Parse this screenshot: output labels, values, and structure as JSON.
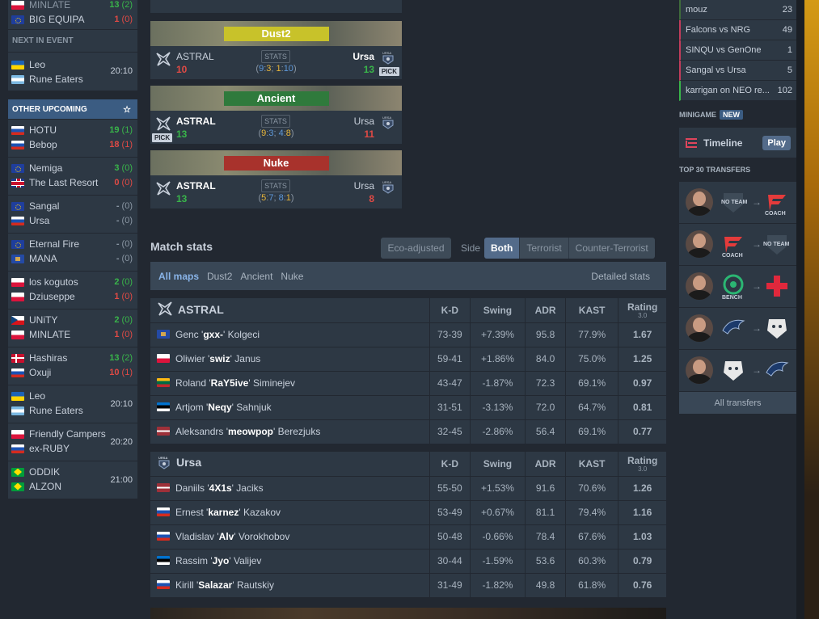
{
  "left_sidebar": {
    "top_match": {
      "team1": "MINLATE",
      "score1": "13",
      "pr1": "(2)",
      "team2": "BIG EQUIPA",
      "score2": "1",
      "pr2": "(0)"
    },
    "next_in_event_label": "NEXT IN EVENT",
    "next_match": {
      "team1": "Leo",
      "team2": "Rune Eaters",
      "time": "20:10"
    },
    "other_upcoming_label": "OTHER UPCOMING",
    "matches": [
      {
        "team1": "HOTU",
        "flag1": "ru",
        "score1": "19",
        "pr1": "(1)",
        "state1": "win",
        "team2": "Bebop",
        "flag2": "ru",
        "score2": "18",
        "pr2": "(1)",
        "state2": "lose"
      },
      {
        "team1": "Nemiga",
        "flag1": "eu",
        "score1": "3",
        "pr1": "(0)",
        "state1": "win",
        "team2": "The Last Resort",
        "flag2": "gb",
        "score2": "0",
        "pr2": "(0)",
        "state2": "lose"
      },
      {
        "team1": "Sangal",
        "flag1": "eu",
        "score1": "-",
        "pr1": "(0)",
        "state1": "none",
        "team2": "Ursa",
        "flag2": "ru",
        "score2": "-",
        "pr2": "(0)",
        "state2": "none"
      },
      {
        "team1": "Eternal Fire",
        "flag1": "eu",
        "score1": "-",
        "pr1": "(0)",
        "state1": "none",
        "team2": "MANA",
        "flag2": "xk",
        "score2": "-",
        "pr2": "(0)",
        "state2": "none"
      },
      {
        "team1": "los kogutos",
        "flag1": "pl",
        "score1": "2",
        "pr1": "(0)",
        "state1": "win",
        "team2": "Dziuseppe",
        "flag2": "pl",
        "score2": "1",
        "pr2": "(0)",
        "state2": "lose"
      },
      {
        "team1": "UNiTY",
        "flag1": "cz",
        "score1": "2",
        "pr1": "(0)",
        "state1": "win",
        "team2": "MINLATE",
        "flag2": "pl",
        "score2": "1",
        "pr2": "(0)",
        "state2": "lose"
      },
      {
        "team1": "Hashiras",
        "flag1": "dk",
        "score1": "13",
        "pr1": "(2)",
        "state1": "win",
        "team2": "Oxuji",
        "flag2": "ru",
        "score2": "10",
        "pr2": "(1)",
        "state2": "lose"
      },
      {
        "team1": "Leo",
        "flag1": "ua",
        "team2": "Rune Eaters",
        "flag2": "ar",
        "time": "20:10"
      },
      {
        "team1": "Friendly Campers",
        "flag1": "pl",
        "team2": "ex-RUBY",
        "flag2": "ru",
        "time": "20:20"
      },
      {
        "team1": "ODDIK",
        "flag1": "br",
        "team2": "ALZON",
        "flag2": "br",
        "time": "21:00"
      }
    ]
  },
  "maps": [
    {
      "name": "Dust2",
      "team1": "ASTRAL",
      "score1": "10",
      "state1": "lose",
      "stats_label": "STATS",
      "h1": "9",
      "h1c": "3",
      "h2": "1",
      "h2c": "10",
      "team2": "Ursa",
      "score2": "13",
      "state2": "win",
      "pick": "PICK",
      "pick_side": "right",
      "banner_color": "#c8c22a"
    },
    {
      "name": "Ancient",
      "team1": "ASTRAL",
      "score1": "13",
      "state1": "win",
      "stats_label": "STATS",
      "h1": "9",
      "h1c": "3",
      "h2": "4",
      "h2c": "8",
      "team2": "Ursa",
      "score2": "11",
      "state2": "lose",
      "pick": "PICK",
      "pick_side": "left",
      "banner_color": "#2f7a3c"
    },
    {
      "name": "Nuke",
      "team1": "ASTRAL",
      "score1": "13",
      "state1": "win",
      "stats_label": "STATS",
      "h1": "5",
      "h1c": "7",
      "h2": "8",
      "h2c": "1",
      "team2": "Ursa",
      "score2": "8",
      "state2": "lose",
      "pick": "",
      "pick_side": "none",
      "banner_color": "#a8322c"
    }
  ],
  "match_stats": {
    "title": "Match stats",
    "eco_label": "Eco-adjusted",
    "side_label": "Side",
    "side_tabs": [
      "Both",
      "Terrorist",
      "Counter-Terrorist"
    ],
    "map_tabs": [
      "All maps",
      "Dust2",
      "Ancient",
      "Nuke"
    ],
    "detailed_label": "Detailed stats",
    "columns": [
      "K-D",
      "Swing",
      "ADR",
      "KAST",
      "Rating"
    ],
    "rating_sub": "3.0",
    "teams": [
      {
        "name": "ASTRAL",
        "players": [
          {
            "flag": "xk",
            "first": "Genc '",
            "nick": "gxx-",
            "last": "' Kolgeci",
            "kd": "73-39",
            "swing": "+7.39%",
            "swing_state": "pos",
            "adr": "95.8",
            "kast": "77.9%",
            "rating": "1.67",
            "rating_state": "pos"
          },
          {
            "flag": "pl",
            "first": "Oliwier '",
            "nick": "swiz",
            "last": "' Janus",
            "kd": "59-41",
            "swing": "+1.86%",
            "swing_state": "pos",
            "adr": "84.0",
            "kast": "75.0%",
            "rating": "1.25",
            "rating_state": "pos"
          },
          {
            "flag": "lt",
            "first": "Roland '",
            "nick": "RaY5ive",
            "last": "' Siminejev",
            "kd": "43-47",
            "swing": "-1.87%",
            "swing_state": "neg",
            "adr": "72.3",
            "kast": "69.1%",
            "rating": "0.97",
            "rating_state": "neutral"
          },
          {
            "flag": "ee",
            "first": "Artjom '",
            "nick": "Neqy",
            "last": "' Sahnjuk",
            "kd": "31-51",
            "swing": "-3.13%",
            "swing_state": "neg",
            "adr": "72.0",
            "kast": "64.7%",
            "rating": "0.81",
            "rating_state": "neg"
          },
          {
            "flag": "lv",
            "first": "Aleksandrs '",
            "nick": "meowpop",
            "last": "' Berezjuks",
            "kd": "32-45",
            "swing": "-2.86%",
            "swing_state": "neg",
            "adr": "56.4",
            "kast": "69.1%",
            "rating": "0.77",
            "rating_state": "neg"
          }
        ]
      },
      {
        "name": "Ursa",
        "players": [
          {
            "flag": "lv",
            "first": "Daniils '",
            "nick": "4X1s",
            "last": "' Jaciks",
            "kd": "55-50",
            "swing": "+1.53%",
            "swing_state": "pos",
            "adr": "91.6",
            "kast": "70.6%",
            "rating": "1.26",
            "rating_state": "pos"
          },
          {
            "flag": "ru",
            "first": "Ernest '",
            "nick": "karnez",
            "last": "' Kazakov",
            "kd": "53-49",
            "swing": "+0.67%",
            "swing_state": "neutral",
            "adr": "81.1",
            "kast": "79.4%",
            "rating": "1.16",
            "rating_state": "pos"
          },
          {
            "flag": "ru",
            "first": "Vladislav '",
            "nick": "Alv",
            "last": "' Vorokhobov",
            "kd": "50-48",
            "swing": "-0.66%",
            "swing_state": "neutral",
            "adr": "78.4",
            "kast": "67.6%",
            "rating": "1.03",
            "rating_state": "neutral"
          },
          {
            "flag": "ee",
            "first": "Rassim '",
            "nick": "Jyo",
            "last": "' Valijev",
            "kd": "30-44",
            "swing": "-1.59%",
            "swing_state": "neg",
            "adr": "53.6",
            "kast": "60.3%",
            "rating": "0.79",
            "rating_state": "neg"
          },
          {
            "flag": "ru",
            "first": "Kirill '",
            "nick": "Salazar",
            "last": "' Rautskiy",
            "kd": "31-49",
            "swing": "-1.82%",
            "swing_state": "neg",
            "adr": "49.8",
            "kast": "61.8%",
            "rating": "0.76",
            "rating_state": "neg"
          }
        ]
      }
    ]
  },
  "right_sidebar": {
    "threads": [
      {
        "title": "mouz",
        "count": "23"
      },
      {
        "title": "Falcons vs NRG",
        "count": "49"
      },
      {
        "title": "SINQU vs GenOne",
        "count": "1"
      },
      {
        "title": "Sangal vs Ursa",
        "count": "5"
      },
      {
        "title": "karrigan on NEO re...",
        "count": "102"
      }
    ],
    "minigame_label": "MINIGAME",
    "new_label": "NEW",
    "timeline_label": "Timeline",
    "play_label": "Play",
    "transfers_label": "TOP 30 TRANSFERS",
    "transfers": [
      {
        "from_label": "NO TEAM",
        "to_label": "COACH",
        "from": "noteam",
        "to": "faze"
      },
      {
        "from_label": "COACH",
        "to_label": "NO TEAM",
        "from": "faze",
        "to": "noteam"
      },
      {
        "from_label": "BENCH",
        "to_label": "",
        "from": "bench",
        "to": "cross"
      },
      {
        "from_label": "",
        "to_label": "",
        "from": "liquid",
        "to": "g2"
      },
      {
        "from_label": "",
        "to_label": "",
        "from": "g2",
        "to": "liquid"
      }
    ],
    "all_transfers_label": "All transfers"
  },
  "colors": {
    "accent": "#3b5c82",
    "win": "#39b54a",
    "lose": "#e04a45",
    "panel": "#2d3844",
    "bg": "#222831"
  }
}
